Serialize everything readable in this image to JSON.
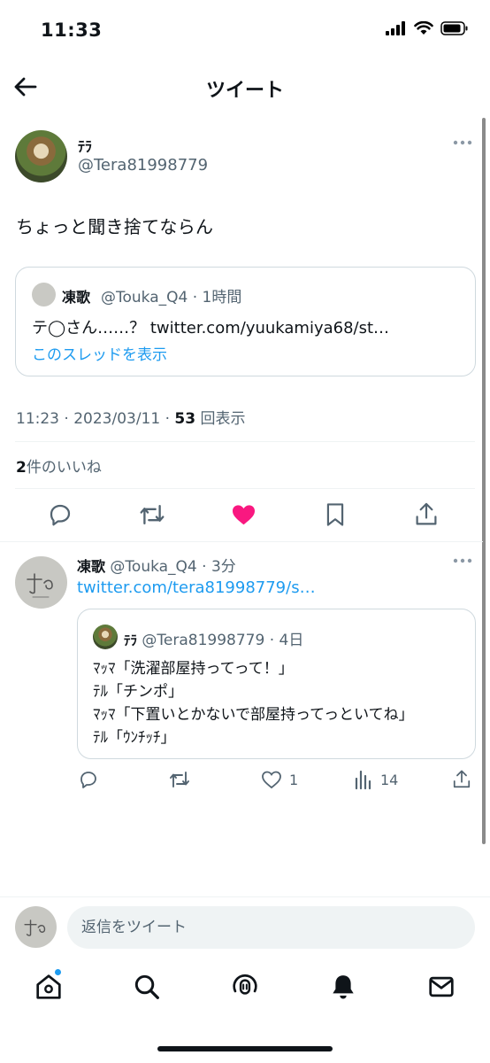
{
  "status_bar": {
    "time": "11:33"
  },
  "header": {
    "title": "ツイート"
  },
  "main_tweet": {
    "display_name": "ﾃﾗ",
    "handle": "@Tera81998779",
    "text": "ちょっと聞き捨てならん",
    "quote": {
      "display_name": "凍歌",
      "meta": "@Touka_Q4 · 1時間",
      "text": "テ◯さん……？ twitter.com/yuukamiya68/st…",
      "show_thread": "このスレッドを表示"
    },
    "timestamp": "11:23 · 2023/03/11 · ",
    "views_count": "53",
    "views_label": "回表示",
    "likes_count": "2",
    "likes_label": "件のいいね"
  },
  "reply_tweet": {
    "display_name": "凍歌",
    "meta": "@Touka_Q4 · 3分",
    "link": "twitter.com/tera81998779/s…",
    "quote": {
      "display_name": "ﾃﾗ",
      "meta": "@Tera81998779 · 4日",
      "lines": [
        "ﾏｯﾏ「洗濯部屋持ってって！」",
        "ﾃﾙ「チンポ」",
        "ﾏｯﾏ「下置いとかないで部屋持ってっといてね」",
        "ﾃﾙ「ｳﾝﾁｯﾁ」"
      ]
    },
    "like_count": "1",
    "views_count": "14"
  },
  "compose": {
    "placeholder": "返信をツイート"
  },
  "colors": {
    "accent": "#1d9bf0",
    "like": "#f91880",
    "text": "#0f1419",
    "muted": "#536471"
  }
}
